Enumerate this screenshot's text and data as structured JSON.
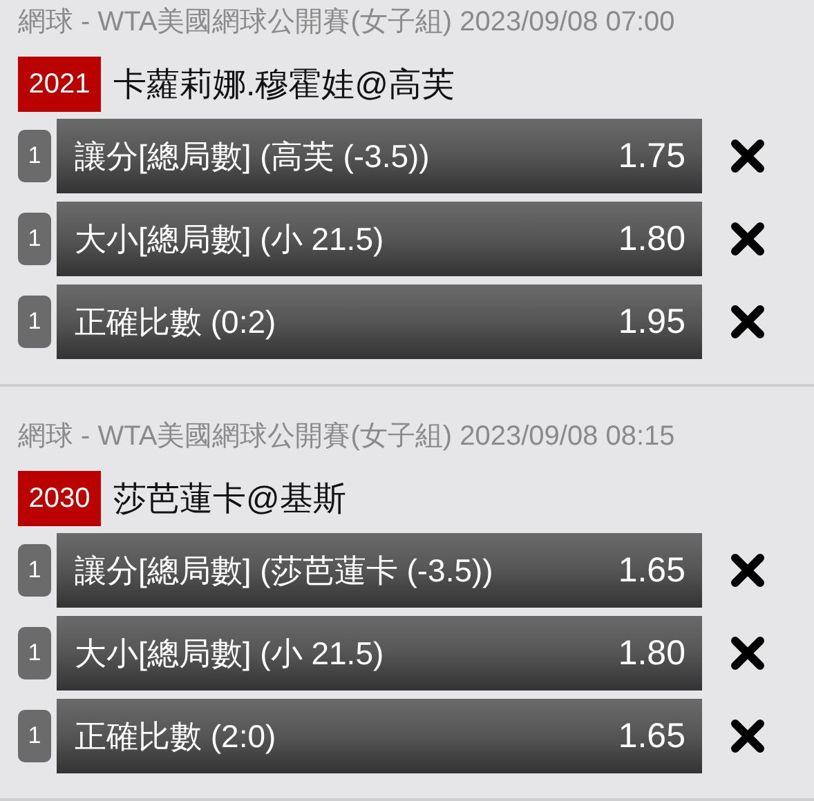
{
  "events": [
    {
      "header": "網球 - WTA美國網球公開賽(女子組) 2023/09/08 07:00",
      "code": "2021",
      "match": "卡蘿莉娜.穆霍娃@高芙",
      "bets": [
        {
          "count": "1",
          "market": "讓分[總局數] (高芙 (-3.5))",
          "odds": "1.75"
        },
        {
          "count": "1",
          "market": "大小[總局數] (小 21.5)",
          "odds": "1.80"
        },
        {
          "count": "1",
          "market": "正確比數 (0:2)",
          "odds": "1.95"
        }
      ]
    },
    {
      "header": "網球 - WTA美國網球公開賽(女子組) 2023/09/08 08:15",
      "code": "2030",
      "match": "莎芭蓮卡@基斯",
      "bets": [
        {
          "count": "1",
          "market": "讓分[總局數] (莎芭蓮卡 (-3.5))",
          "odds": "1.65"
        },
        {
          "count": "1",
          "market": "大小[總局數] (小 21.5)",
          "odds": "1.80"
        },
        {
          "count": "1",
          "market": "正確比數 (2:0)",
          "odds": "1.65"
        }
      ]
    }
  ]
}
